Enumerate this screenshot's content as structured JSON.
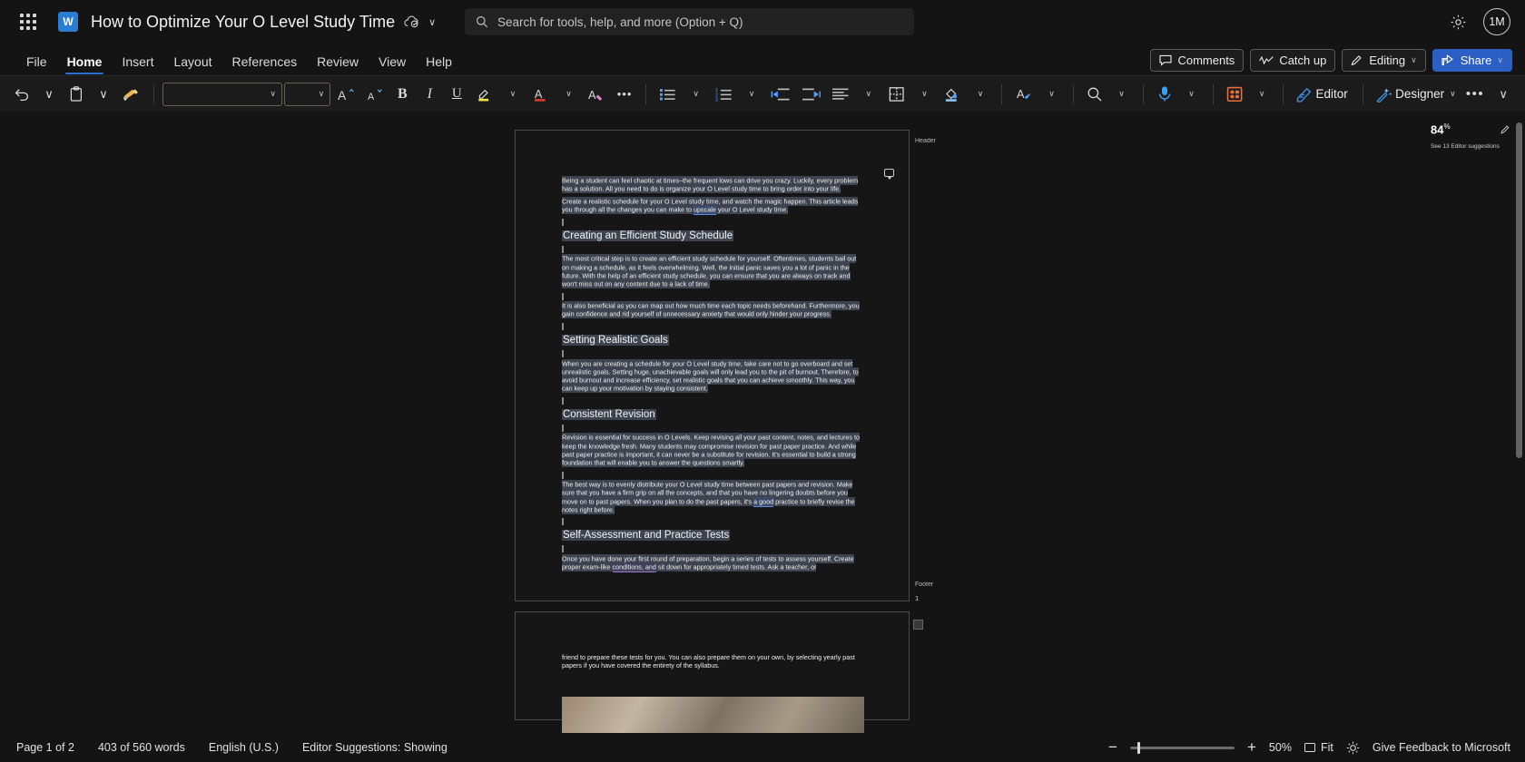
{
  "titlebar": {
    "app_launcher": "app-launcher",
    "app_icon_letter": "W",
    "document_title": "How to Optimize Your O Level Study Time",
    "autosave_cloud_icon": "cloud-saved-icon",
    "title_chevron": "∨",
    "settings_icon": "gear-icon",
    "avatar_initials": "1M"
  },
  "search": {
    "placeholder": "Search for tools, help, and more (Option + Q)",
    "value": ""
  },
  "ribbon_tabs": [
    {
      "label": "File",
      "active": false
    },
    {
      "label": "Home",
      "active": true
    },
    {
      "label": "Insert",
      "active": false
    },
    {
      "label": "Layout",
      "active": false
    },
    {
      "label": "References",
      "active": false
    },
    {
      "label": "Review",
      "active": false
    },
    {
      "label": "View",
      "active": false
    },
    {
      "label": "Help",
      "active": false
    }
  ],
  "ribbon_actions": {
    "comments": "Comments",
    "catch_up": "Catch up",
    "editing": "Editing",
    "editing_chevron": "∨",
    "share": "Share",
    "share_chevron": "∨",
    "collapse_ribbon_chevron": "∨"
  },
  "toolbar": {
    "undo": "undo-icon",
    "undo_chevron": "∨",
    "paste": "paste-icon",
    "paste_chevron": "∨",
    "format_painter": "format-painter-icon",
    "font_name_value": "",
    "font_size_value": "",
    "grow_font": "grow-font-icon",
    "shrink_font": "shrink-font-icon",
    "bold": "B",
    "italic": "I",
    "underline": "U",
    "highlight": "text-highlight-icon",
    "font_color": "font-color-icon",
    "clear_formatting": "clear-formatting-icon",
    "more_font_options": "•••",
    "bullets": "bullet-list-icon",
    "numbering": "numbered-list-icon",
    "decrease_indent": "decrease-indent-icon",
    "increase_indent": "increase-indent-icon",
    "alignment": "align-left-icon",
    "borders": "borders-icon",
    "shading": "shading-icon",
    "styles": "styles-icon",
    "find": "find-icon",
    "dictate": "dictate-icon",
    "add_in": "add-in-icon",
    "editor_label": "Editor",
    "designer_label": "Designer",
    "overflow": "•••"
  },
  "document": {
    "header_label": "Header",
    "footer_label": "Footer",
    "page_number": "1",
    "paragraphs": [
      "Being a student can feel chaotic at times–the frequent lows can drive you crazy. Luckily, every problem has a solution. All you need to do is organize your O Level study time to bring order into your life.",
      "Create a realistic schedule for your O Level study time, and watch the magic happen. This article leads you through all the changes you can make to upscale your O Level study time."
    ],
    "p2_pre": "Create a realistic schedule for your O Level study time, and watch the magic happen. This article leads you through all the changes you can make to ",
    "p2_link": "upscale",
    "p2_post": " your O Level study time.",
    "heading1": "Creating an Efficient Study Schedule",
    "p3": "The most critical step is to create an efficient study schedule for yourself. Oftentimes, students bail out on making a schedule, as it feels overwhelming. Well, the initial panic saves you a lot of panic in the future. With the help of an efficient study schedule, you can ensure that you are always on track and won't miss out on any content due to a lack of time.",
    "p4": "It is also beneficial as you can map out how much time each topic needs beforehand. Furthermore, you gain confidence and rid yourself of unnecessary anxiety that would only hinder your progress.",
    "heading2": "Setting Realistic Goals",
    "p5": "When you are creating a schedule for your O Level study time, take care not to go overboard and set unrealistic goals. Setting huge, unachievable goals will only lead you to the pit of burnout. Therefore, to avoid burnout and increase efficiency, set realistic goals that you can achieve smoothly. This way, you can keep up your motivation by staying consistent.",
    "heading3": "Consistent Revision",
    "p6": "Revision is essential for success in O Levels. Keep revising all your past content, notes, and lectures to keep the knowledge fresh. Many students may compromise revision for past paper practice. And while past paper practice is important, it can never be a substitute for revision. It's essential to build a strong foundation that will enable you to answer the questions smartly.",
    "p7_pre": "The best way is to evenly distribute your O Level study time between past papers and revision. Make sure that you have a firm grip on all the concepts, and that you have no lingering doubts before you move on to past papers. When you plan to do the past papers, it's ",
    "p7_link": "a good",
    "p7_post": " practice to briefly revise the notes right before.",
    "heading4": "Self-Assessment and Practice Tests",
    "p8_pre": "Once you have done your first round of preparation, begin a series of tests to assess yourself. Create proper exam-like ",
    "p8_link": "conditions, and",
    "p8_post": " sit down for appropriately timed tests. Ask a teacher, or",
    "page2_text": "friend to prepare these tests for you. You can also prepare them on your own, by selecting yearly past papers if you have covered the entirety of the syllabus."
  },
  "editor_pane": {
    "score": "84",
    "score_unit": "%",
    "suggestions_text": "See 13 Editor suggestions",
    "pen_icon": "pen-icon"
  },
  "statusbar": {
    "page_info": "Page 1 of 2",
    "word_count": "403 of 560 words",
    "language": "English (U.S.)",
    "editor_suggestions": "Editor Suggestions: Showing",
    "zoom_out": "−",
    "zoom_in": "+",
    "zoom_level": "50%",
    "fit_label": "Fit",
    "focus_icon": "brightness-icon",
    "feedback": "Give Feedback to Microsoft"
  },
  "colors": {
    "accent_blue": "#2b5fc4",
    "tab_underline": "#2b6fd6",
    "selection": "#3d4450",
    "window_bg": "#141414",
    "toolbar_bg": "#1b1b1b"
  }
}
